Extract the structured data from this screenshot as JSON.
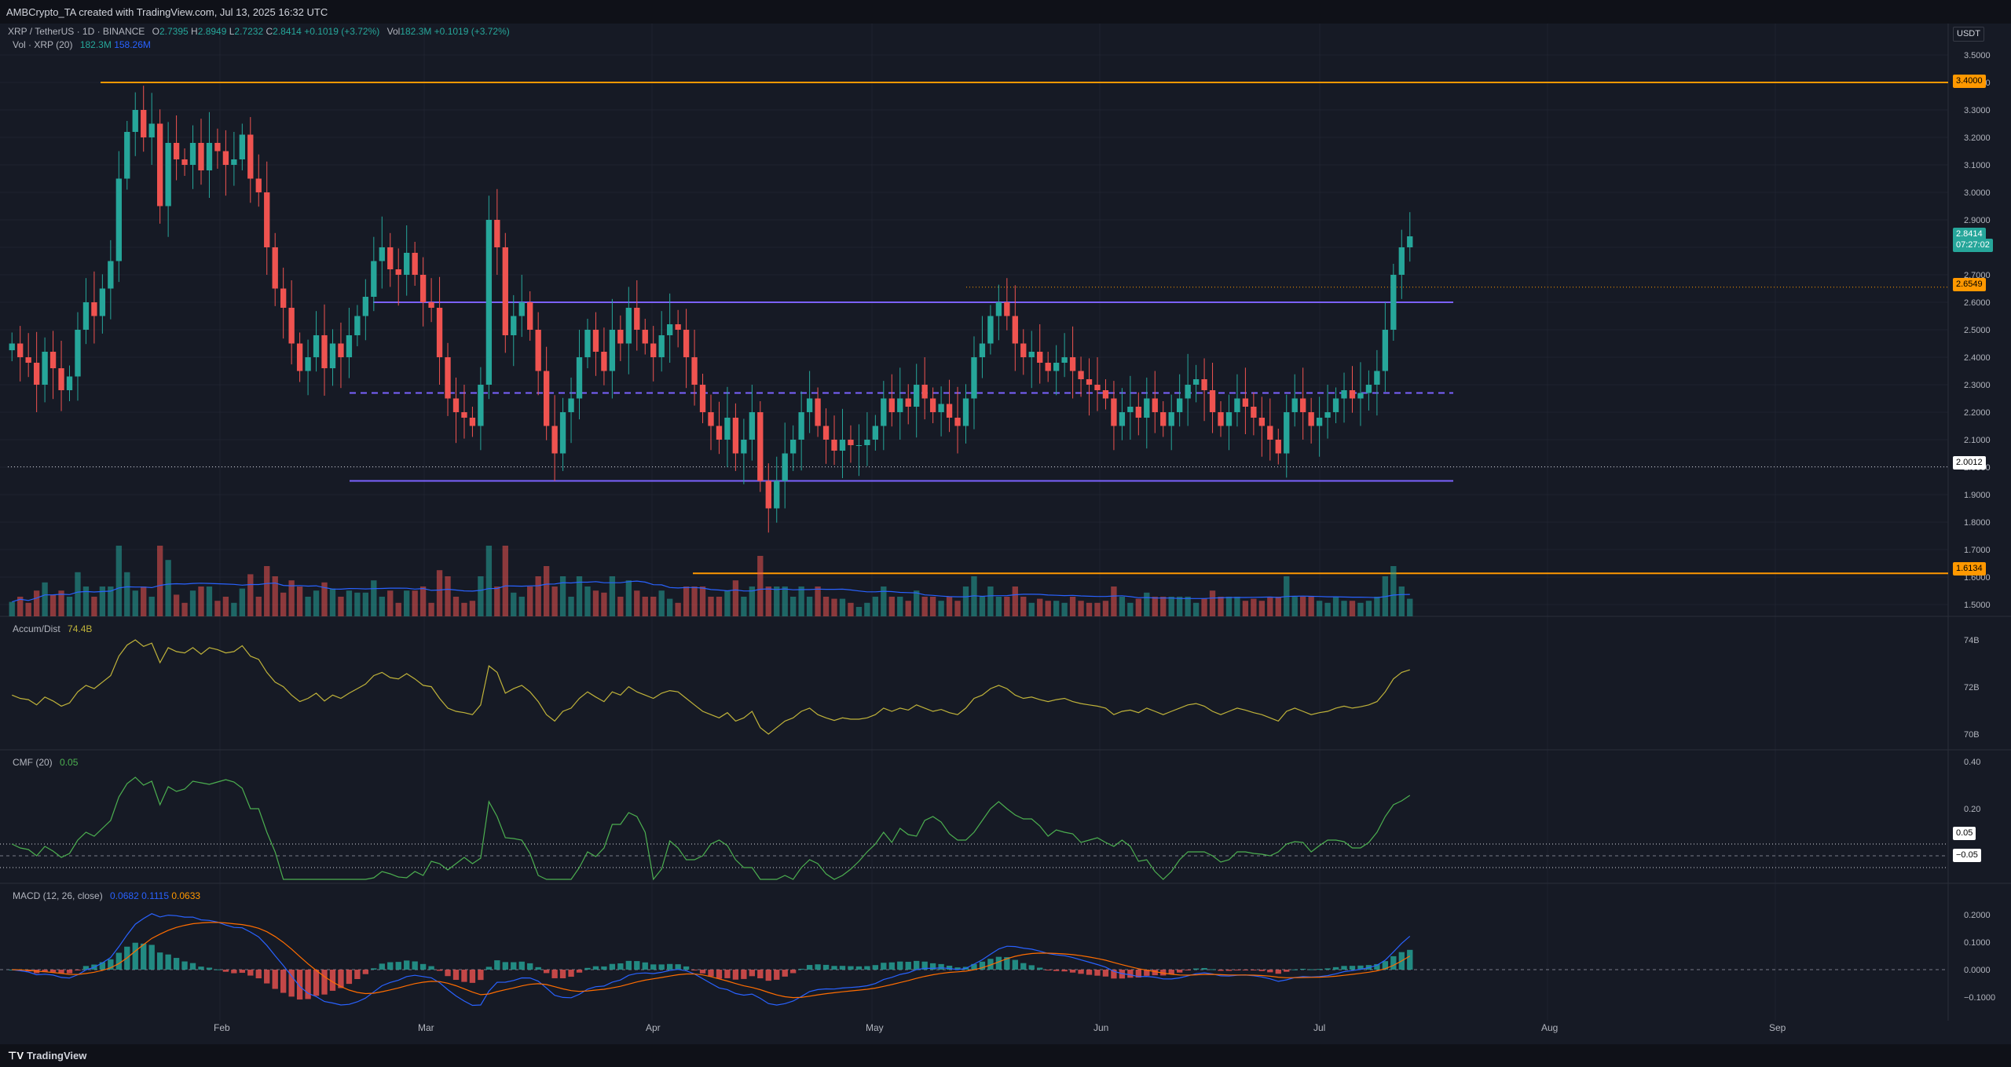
{
  "header": {
    "caption": "AMBCrypto_TA created with TradingView.com, Jul 13, 2025 16:32 UTC"
  },
  "footer": {
    "brand": "TradingView"
  },
  "legend": {
    "symbol": "XRP / TetherUS · 1D · BINANCE",
    "open_label": "O",
    "open": "2.7395",
    "high_label": "H",
    "high": "2.8949",
    "low_label": "L",
    "low": "2.7232",
    "close_label": "C",
    "close": "2.8414",
    "change": "+0.1019 (+3.72%)",
    "vol_label": "Vol",
    "vol": "182.3M",
    "vol_change": "+0.1019 (+3.72%)",
    "vol_ind_label": "Vol · XRP (20)",
    "vol_value": "182.3M",
    "vol_ma": "158.26M",
    "ad_label": "Accum/Dist",
    "ad_value": "74.4B",
    "cmf_label": "CMF (20)",
    "cmf_value": "0.05",
    "macd_label": "MACD (12, 26, close)",
    "macd_value": "0.0682",
    "macd_signal": "0.1115",
    "macd_hist": "0.0633"
  },
  "currency_button": "USDT",
  "tags": {
    "level_top": "3.4000",
    "last_price": "2.8414",
    "countdown": "07:27:02",
    "level_mid": "2.6549",
    "level_support": "2.0012",
    "level_bottom": "1.6134",
    "cmf_pos": "0.05",
    "cmf_neg": "−0.05"
  },
  "colors": {
    "up": "#26a69a",
    "down": "#ef5350",
    "orange": "#ff9800",
    "purple": "#7b61ff",
    "ad": "#c0b33a",
    "cmf": "#4caf50",
    "macd": "#2962ff",
    "signal": "#ff6d00",
    "volma": "#2962ff"
  },
  "chart_data": {
    "type": "candlestick",
    "symbol": "XRP / TetherUS",
    "timeframe": "1D",
    "price_axis_ticks": [
      "3.5000",
      "3.4000",
      "3.3000",
      "3.2000",
      "3.1000",
      "3.0000",
      "2.9000",
      "2.8000",
      "2.7000",
      "2.6000",
      "2.5000",
      "2.4000",
      "2.3000",
      "2.2000",
      "2.1000",
      "2.0000",
      "1.9000",
      "1.8000",
      "1.7000",
      "1.6000",
      "1.5000"
    ],
    "ylim": [
      1.45,
      3.55
    ],
    "time_axis_labels": [
      "Feb",
      "Mar",
      "Apr",
      "May",
      "Jun",
      "Jul",
      "Aug",
      "Sep"
    ],
    "levels": {
      "resistance_high": 3.4,
      "resistance_mid": 2.6549,
      "range_high": 2.6,
      "range_mid": 2.27,
      "support": 2.0012,
      "range_low": 1.95,
      "support_low": 1.6134
    },
    "closes": [
      2.45,
      2.4,
      2.38,
      2.3,
      2.42,
      2.36,
      2.28,
      2.33,
      2.5,
      2.6,
      2.55,
      2.65,
      2.75,
      3.05,
      3.22,
      3.3,
      3.2,
      3.25,
      2.95,
      3.18,
      3.12,
      3.1,
      3.18,
      3.08,
      3.18,
      3.15,
      3.1,
      3.12,
      3.21,
      3.05,
      3.0,
      2.8,
      2.65,
      2.58,
      2.45,
      2.35,
      2.4,
      2.48,
      2.36,
      2.45,
      2.4,
      2.48,
      2.55,
      2.62,
      2.75,
      2.8,
      2.72,
      2.7,
      2.78,
      2.7,
      2.6,
      2.58,
      2.4,
      2.25,
      2.2,
      2.18,
      2.15,
      2.3,
      2.9,
      2.8,
      2.48,
      2.55,
      2.6,
      2.5,
      2.35,
      2.15,
      2.05,
      2.2,
      2.25,
      2.4,
      2.5,
      2.42,
      2.35,
      2.5,
      2.45,
      2.58,
      2.5,
      2.45,
      2.4,
      2.48,
      2.52,
      2.5,
      2.4,
      2.3,
      2.2,
      2.15,
      2.1,
      2.18,
      2.05,
      2.1,
      2.2,
      1.95,
      1.85,
      1.95,
      2.05,
      2.1,
      2.2,
      2.25,
      2.15,
      2.1,
      2.06,
      2.1,
      2.08,
      2.08,
      2.1,
      2.15,
      2.25,
      2.2,
      2.25,
      2.22,
      2.3,
      2.25,
      2.2,
      2.23,
      2.18,
      2.15,
      2.25,
      2.4,
      2.45,
      2.55,
      2.6,
      2.55,
      2.45,
      2.4,
      2.42,
      2.38,
      2.35,
      2.38,
      2.4,
      2.35,
      2.32,
      2.3,
      2.28,
      2.25,
      2.15,
      2.2,
      2.22,
      2.18,
      2.25,
      2.2,
      2.15,
      2.2,
      2.25,
      2.3,
      2.32,
      2.28,
      2.2,
      2.15,
      2.2,
      2.25,
      2.22,
      2.18,
      2.15,
      2.1,
      2.05,
      2.2,
      2.25,
      2.2,
      2.15,
      2.18,
      2.2,
      2.25,
      2.28,
      2.25,
      2.27,
      2.3,
      2.35,
      2.5,
      2.7,
      2.8,
      2.84
    ],
    "ad_axis_ticks": [
      "74B",
      "72B",
      "70B"
    ],
    "ad_last": "74.4B",
    "cmf_axis_ticks": [
      "0.40",
      "0.20",
      "0.05",
      "−0.05"
    ],
    "cmf_last": 0.05,
    "macd_axis_ticks": [
      "0.2000",
      "0.1000",
      "0.0000",
      "−0.1000"
    ],
    "macd_last": {
      "macd": 0.0682,
      "signal": 0.1115,
      "histogram": 0.0633
    }
  }
}
